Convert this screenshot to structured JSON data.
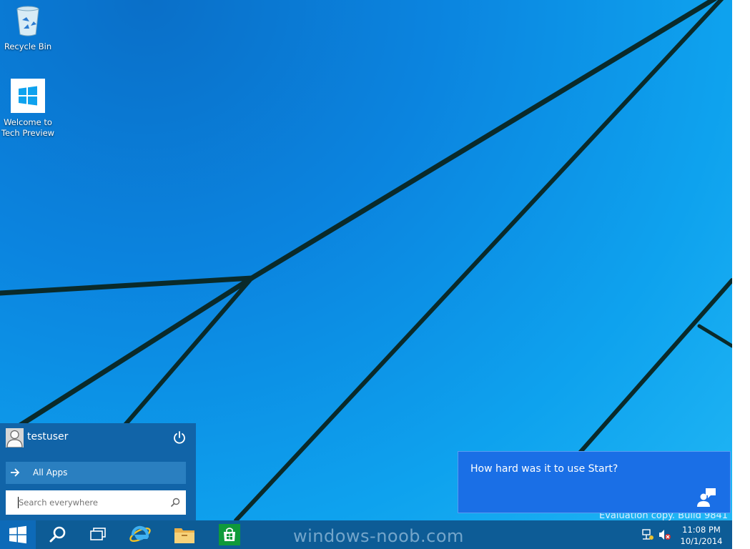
{
  "desktop": {
    "icons": [
      {
        "label": "Recycle Bin",
        "icon": "recycle-bin-icon"
      },
      {
        "label_line1": "Welcome to",
        "label_line2": "Tech Preview",
        "icon": "windows-logo-icon"
      }
    ]
  },
  "start_menu": {
    "user_name": "testuser",
    "all_apps_label": "All Apps",
    "search_placeholder": "Search everywhere",
    "search_value": ""
  },
  "feedback_toast": {
    "text": "How hard was it to use Start?",
    "icon": "feedback-icon"
  },
  "watermark": {
    "build_text": "Evaluation copy. Build 9841",
    "site_text": "windows-noob.com"
  },
  "taskbar": {
    "buttons": [
      "start-icon",
      "search-icon",
      "task-view-icon",
      "internet-explorer-icon",
      "file-explorer-icon",
      "store-icon"
    ],
    "tray": [
      "network-icon",
      "volume-muted-icon"
    ],
    "clock": {
      "time": "11:08 PM",
      "date": "10/1/2014"
    }
  },
  "colors": {
    "start_menu_bg": "#1164a8",
    "taskbar_bg": "#0d5c96",
    "toast_bg": "#1a6fe6"
  }
}
